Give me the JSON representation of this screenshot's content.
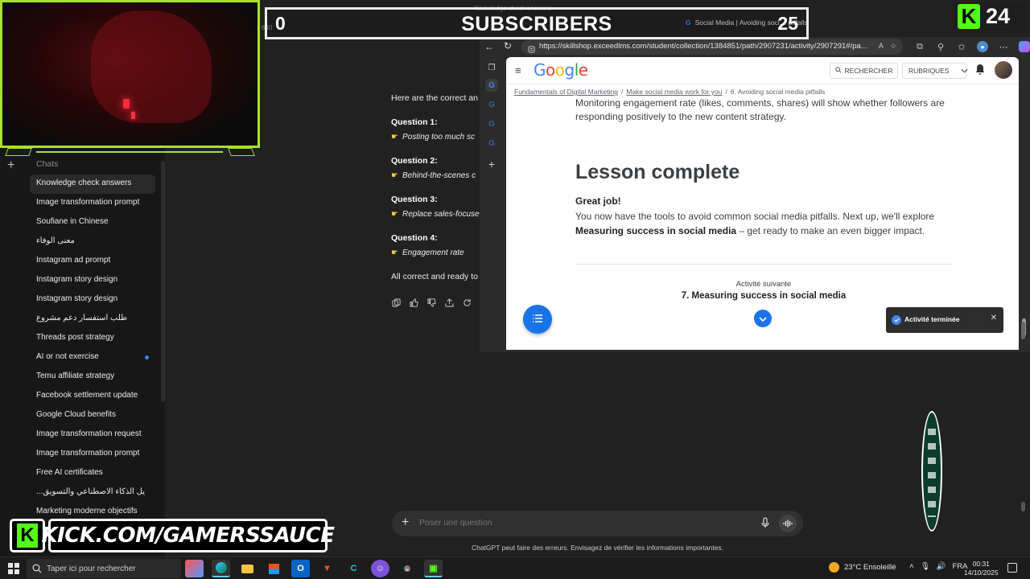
{
  "chatgpt": {
    "sidebar": {
      "chats_label": "Chats",
      "items": [
        {
          "label": "Knowledge check answers",
          "active": true
        },
        {
          "label": "Image transformation prompt"
        },
        {
          "label": "Soufiane in Chinese"
        },
        {
          "label": "معنى الوفاء"
        },
        {
          "label": "Instagram ad prompt"
        },
        {
          "label": "Instagram story design"
        },
        {
          "label": "Instagram story design"
        },
        {
          "label": "طلب استفسار دعم مشروع"
        },
        {
          "label": "Threads post strategy"
        },
        {
          "label": "AI or not exercise",
          "unread": true
        },
        {
          "label": "Temu affiliate strategy"
        },
        {
          "label": "Facebook settlement update"
        },
        {
          "label": "Google Cloud benefits"
        },
        {
          "label": "Image transformation request"
        },
        {
          "label": "Image transformation prompt"
        },
        {
          "label": "Free AI certificates"
        },
        {
          "label": "...يل الذكاء الاصطناعي والتسويق"
        },
        {
          "label": "Marketing moderne objectifs"
        }
      ]
    },
    "message": {
      "intro": "Here are the correct an",
      "questions": [
        {
          "title": "Question 1:",
          "answer": "Posting too much sc"
        },
        {
          "title": "Question 2:",
          "answer": "Behind-the-scenes c"
        },
        {
          "title": "Question 3:",
          "answer": "Replace sales-focuse"
        },
        {
          "title": "Question 4:",
          "answer": "Engagement rate"
        }
      ],
      "closing": "All correct and ready to"
    },
    "composer": {
      "placeholder": "Poser une question",
      "disclaimer": "ChatGPT peut faire des erreurs. Envisagez de vérifier les informations importantes."
    }
  },
  "window": {
    "caption": "Knowledge check answers",
    "tab_title": "Social Media | Avoiding soci… pitfalls",
    "url": "https://skillshop.exceedlms.com/student/collection/1384851/path/2907231/activity/2907291#/pa..."
  },
  "skillshop": {
    "logo": "Google",
    "search_label": "RECHERCHER",
    "topics_label": "RUBRIQUES",
    "breadcrumb": [
      "Fundamentals of Digital Marketing",
      "Make social media work for you",
      "6. Avoiding social media pitfalls"
    ],
    "prev_text": "Monitoring engagement rate (likes, comments, shares) will show whether followers are responding positively to the new content strategy.",
    "lesson_title": "Lesson complete",
    "great_job": "Great job!",
    "body_intro": "You now have the tools to avoid common social media pitfalls. Next up, we'll explore",
    "body_bold": "Measuring success in social media",
    "body_end": " – get ready to make an even bigger impact.",
    "next_label": "Activité suivante",
    "next_title": "7. Measuring success in social media",
    "toast": "Activité terminée"
  },
  "overlay": {
    "subs_left": "0",
    "subs_label": "SUBSCRIBERS",
    "subs_right": "25",
    "kick_count": "24",
    "kick_url": "KICK.COM/GAMERSSAUCE",
    "webcam_label": "640"
  },
  "taskbar": {
    "search_placeholder": "Taper ici pour rechercher",
    "weather": "23°C  Ensoleillé",
    "lang": "FRA",
    "time": "00:31",
    "date": "14/10/2025"
  },
  "colors": {
    "kick_green": "#53fc18",
    "frame_green": "#a6e22e",
    "google_blue": "#1a73e8"
  }
}
